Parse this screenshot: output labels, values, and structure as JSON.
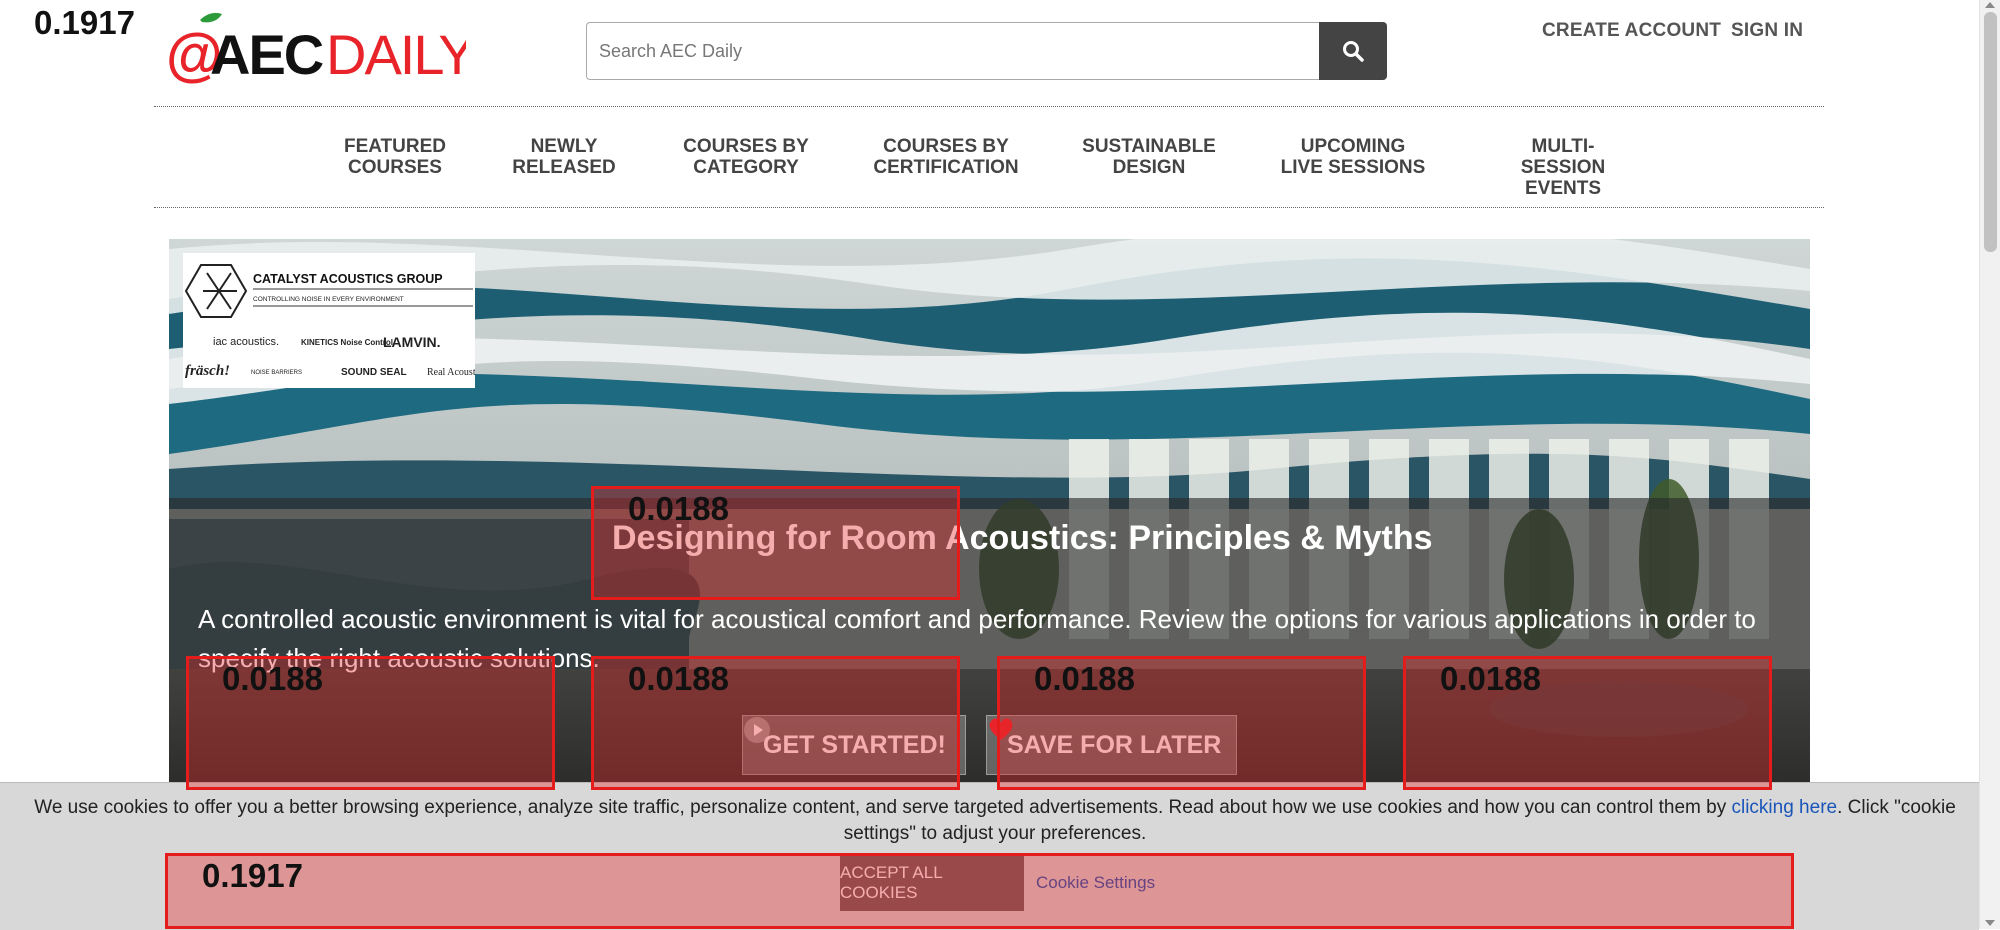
{
  "overlay": {
    "page_score": "0.1917",
    "box_scores": [
      "0.0188",
      "0.0188",
      "0.0188",
      "0.0188",
      "0.0188",
      "0.1917"
    ]
  },
  "header": {
    "search_placeholder": "Search AEC Daily",
    "create_account": "CREATE ACCOUNT",
    "sign_in": "SIGN IN"
  },
  "nav": [
    {
      "label": "FEATURED\nCOURSES"
    },
    {
      "label": "NEWLY\nRELEASED"
    },
    {
      "label": "COURSES BY\nCATEGORY"
    },
    {
      "label": "COURSES BY\nCERTIFICATION"
    },
    {
      "label": "SUSTAINABLE\nDESIGN"
    },
    {
      "label": "UPCOMING\nLIVE SESSIONS"
    },
    {
      "label": "MULTI-SESSION\nEVENTS"
    }
  ],
  "hero": {
    "title": "Designing for Room Acoustics: Principles & Myths",
    "description": "A controlled acoustic environment is vital for acoustical comfort and performance. Review the options for various applications in order to specify the right acoustic solutions.",
    "get_started": "GET STARTED!",
    "save_for_later": "SAVE FOR LATER"
  },
  "sponsor": {
    "name": "CATALYST ACOUSTICS GROUP",
    "tagline": "CONTROLLING NOISE IN EVERY ENVIRONMENT",
    "brands": [
      "iac acoustics.",
      "KINETICS Noise Control",
      "LAMVIN.",
      "fräsch!",
      "NOISE BARRIERS",
      "SOUND SEAL",
      "Real Acoustix"
    ]
  },
  "cookie": {
    "text_before": " We use cookies to offer you a better browsing experience, analyze site traffic, personalize content, and serve targeted advertisements. Read about how we use cookies and how you can control them by ",
    "link": "clicking here",
    "text_after": ". Click \"cookie settings\" to adjust your preferences.",
    "accept": "ACCEPT ALL COOKIES",
    "settings": "Cookie Settings"
  },
  "colors": {
    "brand_red": "#e8232a",
    "highlight_red": "#e51c1c",
    "link_blue": "#1a55b8"
  }
}
